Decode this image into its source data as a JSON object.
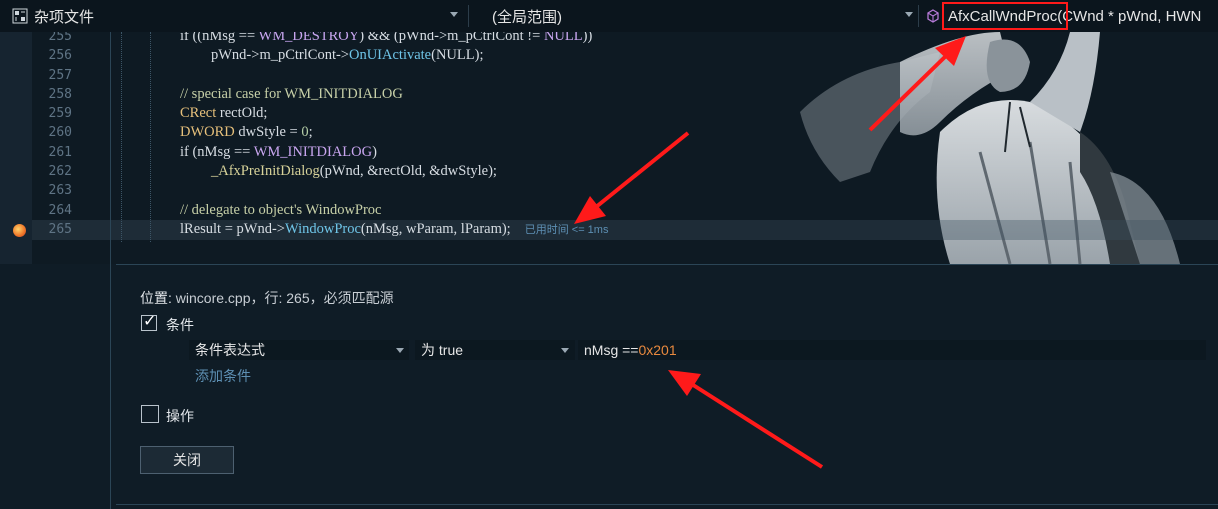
{
  "navbar": {
    "file_label": "杂项文件",
    "scope_label": "(全局范围)",
    "function_signature_name": "AfxCallWndProc",
    "function_signature_rest": "(CWnd * pWnd, HWN"
  },
  "editor": {
    "lines": [
      {
        "num": "255"
      },
      {
        "num": "256"
      },
      {
        "num": "257"
      },
      {
        "num": "258"
      },
      {
        "num": "259"
      },
      {
        "num": "260"
      },
      {
        "num": "261"
      },
      {
        "num": "262"
      },
      {
        "num": "263"
      },
      {
        "num": "264"
      },
      {
        "num": "265"
      }
    ],
    "code": {
      "l255_a": "if ((nMsg == ",
      "l255_b": "WM_DESTROY",
      "l255_c": ") && (pWnd->m_pCtrlCont != ",
      "l255_d": "NULL",
      "l255_e": "))",
      "l256_a": "pWnd->m_pCtrlCont->",
      "l256_b": "OnUIActivate",
      "l256_c": "(NULL);",
      "l258": "// special case for WM_INITDIALOG",
      "l259_a": "CRect",
      "l259_b": " rectOld;",
      "l260_a": "DWORD",
      "l260_b": " dwStyle = ",
      "l260_c": "0",
      "l260_d": ";",
      "l261_a": "if (nMsg == ",
      "l261_b": "WM_INITDIALOG",
      "l261_c": ")",
      "l262_a": "_AfxPreInitDialog",
      "l262_b": "(pWnd, &rectOld, &dwStyle);",
      "l264": "// delegate to object's WindowProc",
      "l265_a": "lResult = pWnd->",
      "l265_b": "WindowProc",
      "l265_c": "(nMsg, wParam, lParam);",
      "l265_timer": "已用时间 <= 1ms"
    }
  },
  "breakpoint_settings": {
    "location_label": "位置:",
    "location_value": "wincore.cpp，行: 265，必须匹配源",
    "conditions_label": "条件",
    "conditions_checked": true,
    "condition_type": "条件表达式",
    "condition_mode": "为 true",
    "expression_prefix": "nMsg ==",
    "expression_hex": "0x201",
    "add_condition": "添加条件",
    "actions_label": "操作",
    "actions_checked": false,
    "close_button": "关闭"
  },
  "colors": {
    "highlight_box": "#ff1a1a",
    "arrow": "#ff1a1a",
    "hex_literal": "#e8893e"
  }
}
